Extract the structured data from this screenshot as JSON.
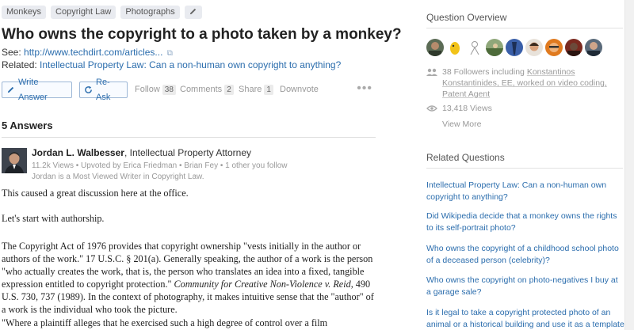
{
  "topics": [
    "Monkeys",
    "Copyright Law",
    "Photographs"
  ],
  "question": {
    "title": "Who owns the copyright to a photo taken by a monkey?",
    "see_label": "See:",
    "see_link": "http://www.techdirt.com/articles...",
    "related_label": "Related:",
    "related_link": "Intellectual Property Law: Can a non-human own copyright to anything?"
  },
  "actions": {
    "write_answer": "Write Answer",
    "re_ask": "Re-Ask",
    "follow": "Follow",
    "follow_count": "38",
    "comments": "Comments",
    "comments_count": "2",
    "share": "Share",
    "share_count": "1",
    "downvote": "Downvote",
    "more": "•••"
  },
  "answers_header": "5 Answers",
  "answer": {
    "author": "Jordan L. Walbesser",
    "credential": ", Intellectual Property Attorney",
    "meta": "11.2k Views • Upvoted by Erica Friedman • Brian Fey • 1 other you follow",
    "meta2": "Jordan is a Most Viewed Writer in Copyright Law.",
    "p1": "This caused a great discussion here at the office.",
    "p2": "Let's start with authorship.",
    "p3a": "The Copyright Act of 1976 provides that copyright ownership \"vests initially in the author or authors of the work.\" 17 U.S.C. § 201(a). Generally speaking, the author of a work is the person \"who actually creates the work, that is, the person who translates an idea into a fixed, tangible expression entitled to copyright protection.\" ",
    "p3_case": "Community for Creative Non-Violence v. Reid",
    "p3b": ", 490 U.S. 730, 737 (1989).  In the context of photography, it makes intuitive sense that the \"author\" of a work is the individual who took the picture.",
    "p4": "\"Where a plaintiff alleges that he exercised such a high degree of control over a film"
  },
  "sidebar": {
    "overview_heading": "Question Overview",
    "followers": "38 Followers including Konstantinos Konstantinides, EE, worked on video coding, Patent Agent",
    "followers_prefix": "38 Followers including ",
    "followers_names": "Konstantinos Konstantinides, EE, worked on video coding, Patent Agent",
    "views": "13,418 Views",
    "view_more": "View More",
    "related_heading": "Related Questions",
    "related_questions": [
      "Intellectual Property Law: Can a non-human own copyright to anything?",
      "Did Wikipedia decide that a monkey owns the rights to its self-portrait photo?",
      "Who owns the copyright of a childhood school photo of a deceased person (celebrity)?",
      "Who owns the copyright on photo-negatives I buy at a garage sale?",
      "Is it legal to take a copyright protected photo of an animal or a historical building and use it as a template"
    ]
  },
  "colors": {
    "link": "#2b6dad",
    "muted": "#999999",
    "chip_bg": "#e9ebf0"
  },
  "icons": [
    "pencil-icon",
    "external-link-icon",
    "refresh-icon",
    "people-icon",
    "eye-icon"
  ]
}
